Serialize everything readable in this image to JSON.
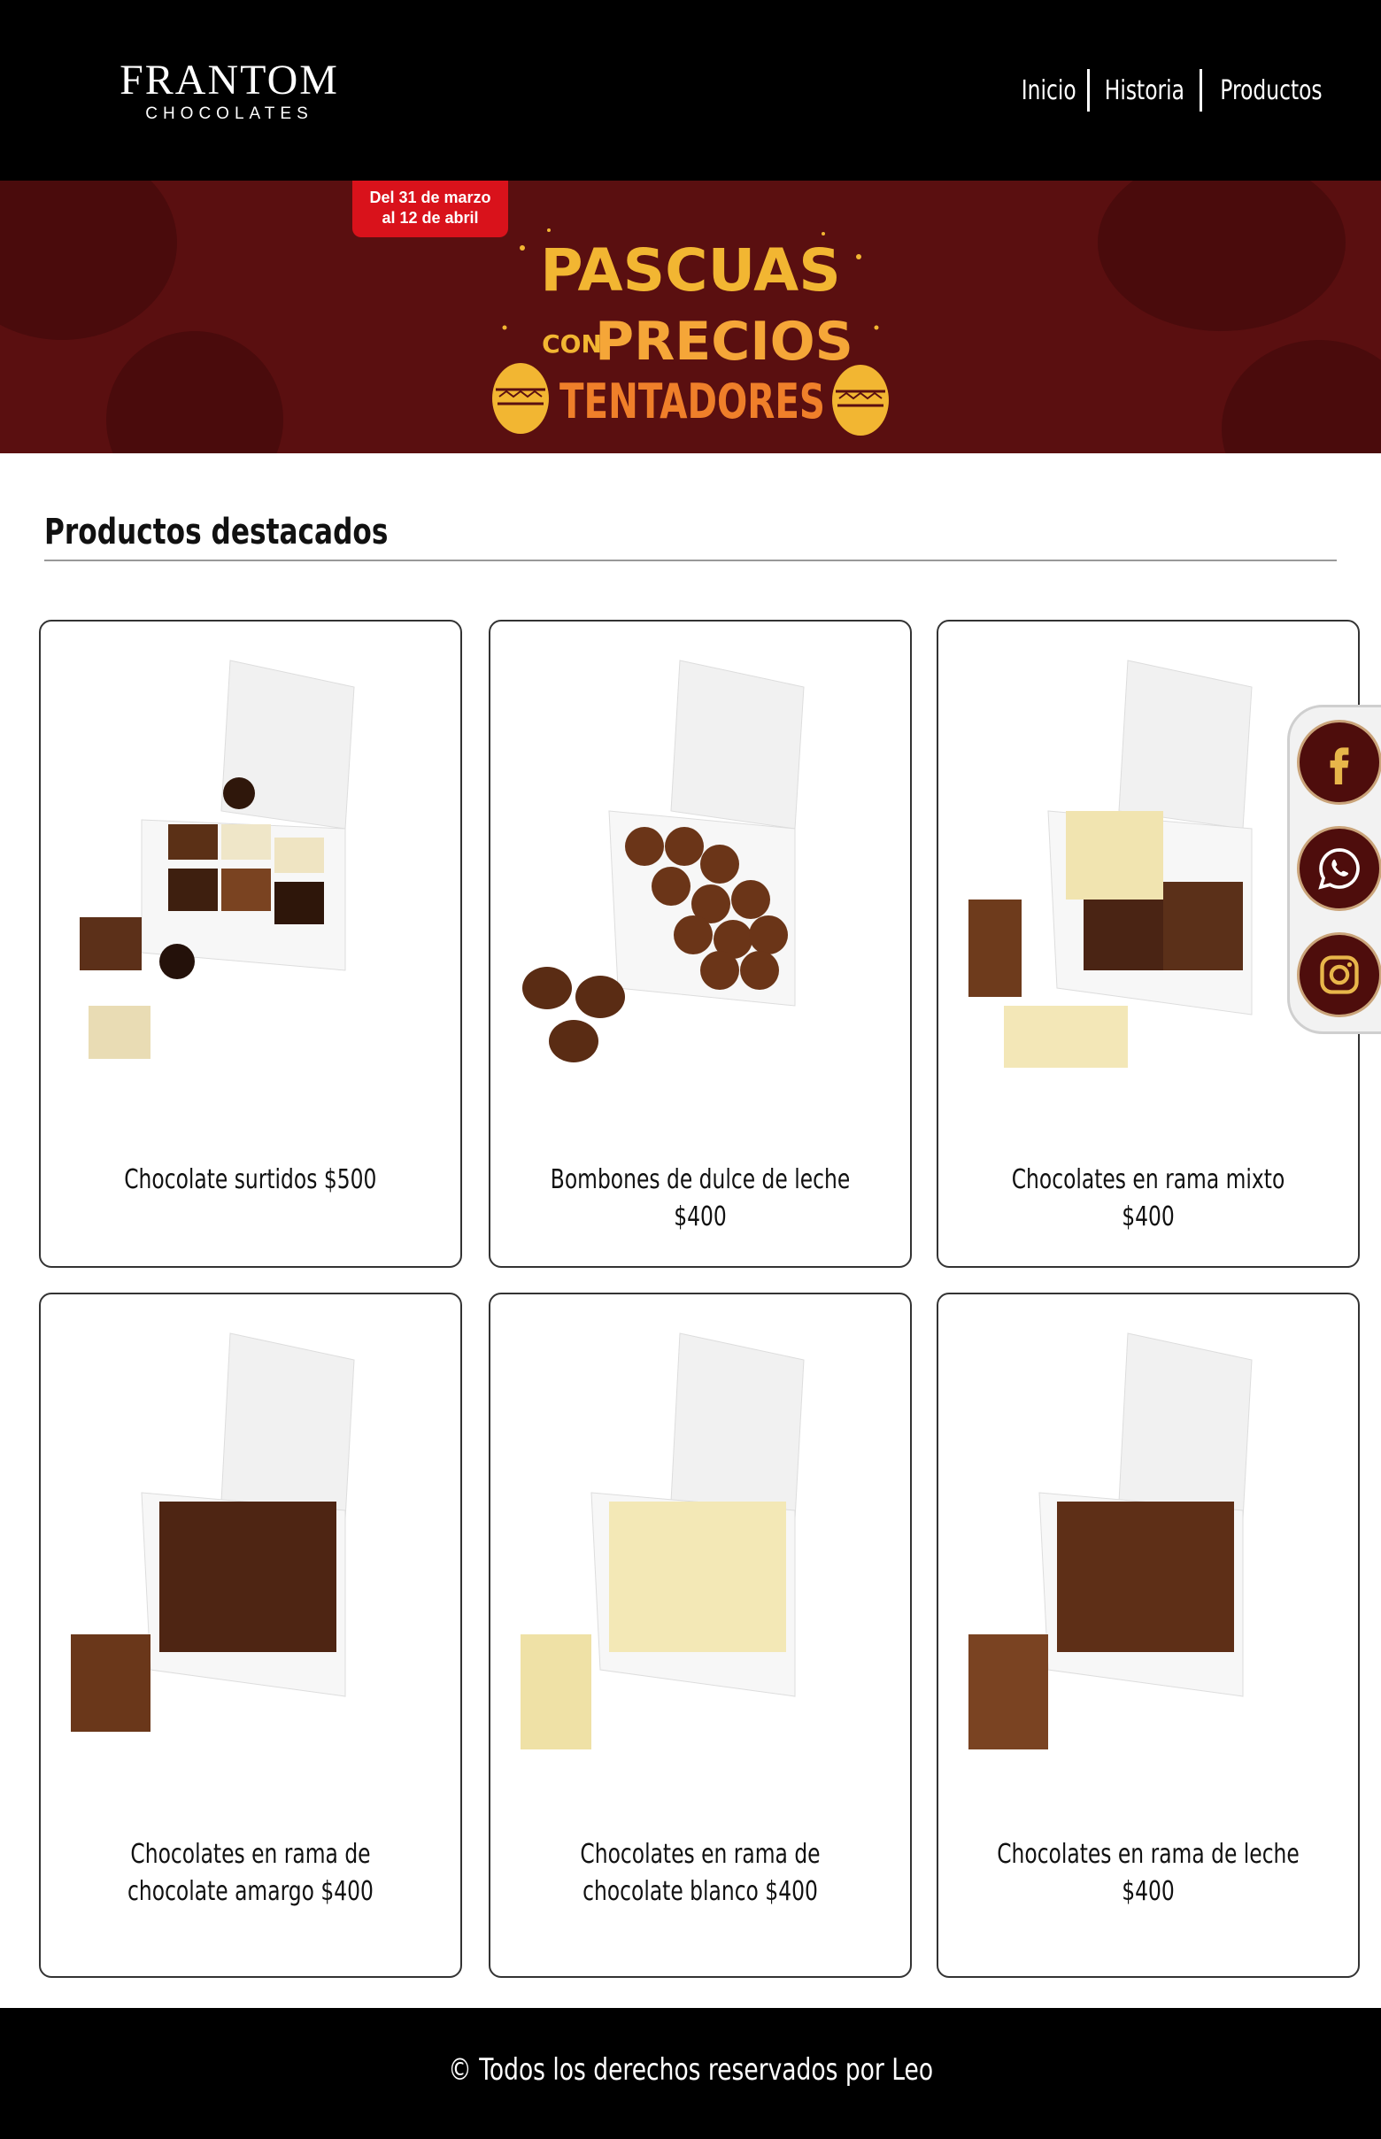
{
  "header": {
    "logo_main": "FRANTOM",
    "logo_sub": "CHOCOLATES",
    "nav": [
      "Inicio",
      "Historia",
      "Productos"
    ]
  },
  "banner": {
    "date_line1": "Del 31 de marzo",
    "date_line2": "al 12 de abril",
    "headline_1": "PASCUAS",
    "headline_2a": "CON",
    "headline_2b": "PRECIOS",
    "headline_3": "TENTADORES"
  },
  "section": {
    "title": "Productos destacados"
  },
  "products": [
    {
      "label": "Chocolate surtidos $500"
    },
    {
      "label": "Bombones de dulce de leche $400"
    },
    {
      "label": "Chocolates en rama mixto $400"
    },
    {
      "label": "Chocolates en rama de chocolate amargo $400"
    },
    {
      "label": "Chocolates en rama de chocolate blanco $400"
    },
    {
      "label": "Chocolates en rama de leche $400"
    }
  ],
  "social": [
    "facebook-icon",
    "whatsapp-icon",
    "instagram-icon"
  ],
  "footer": {
    "text": "© Todos los derechos reservados por Leo"
  },
  "colors": {
    "header_bg": "#000000",
    "banner_bg": "#5a0f10",
    "badge": "#d9121b",
    "headline": "#f2b632",
    "social_btn": "#4e0d0c"
  }
}
